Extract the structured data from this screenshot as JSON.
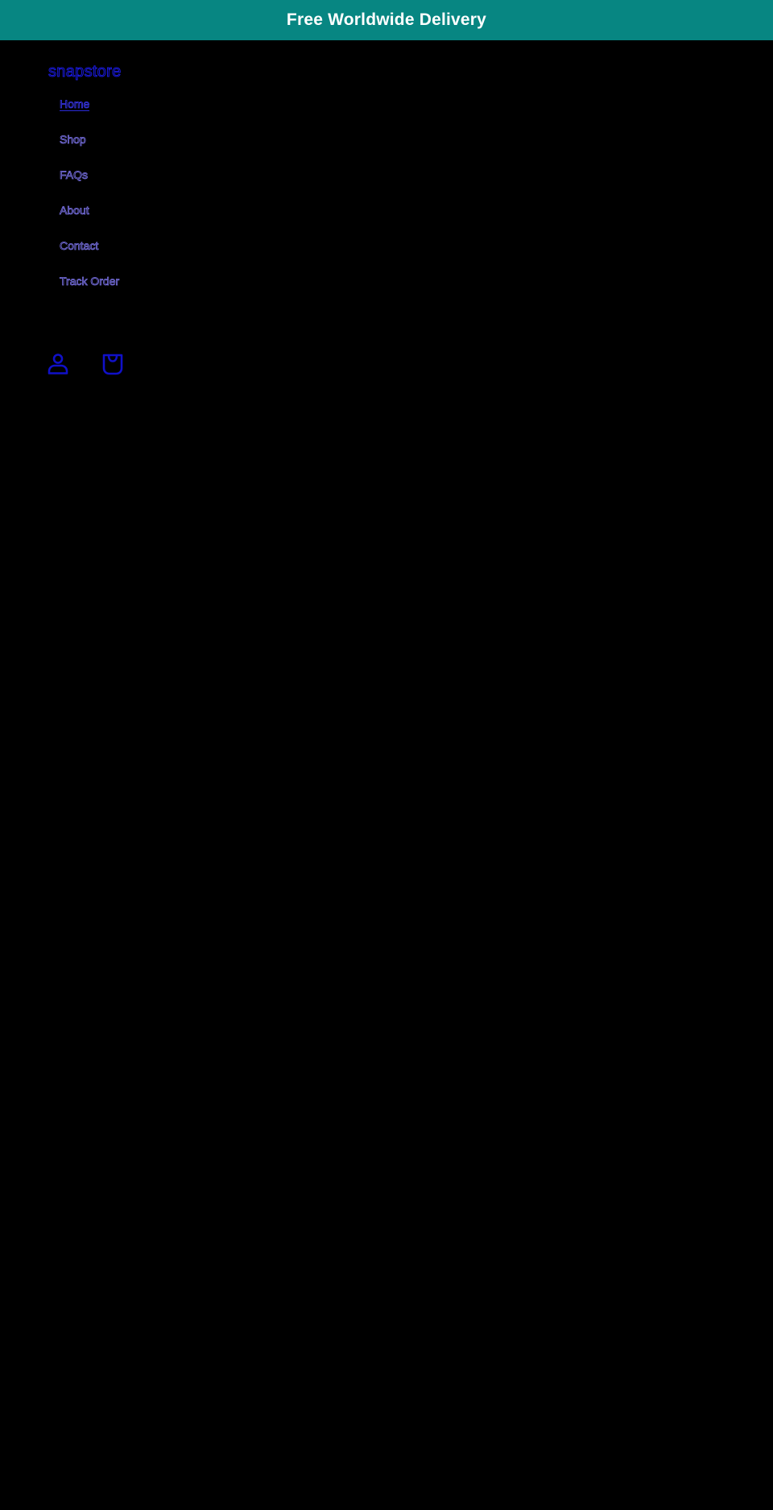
{
  "announcement": {
    "text": "Free Worldwide Delivery"
  },
  "header": {
    "brand": "snapstore"
  },
  "nav": {
    "items": [
      {
        "label": "Home",
        "active": true
      },
      {
        "label": "Shop"
      },
      {
        "label": "FAQs"
      },
      {
        "label": "About"
      },
      {
        "label": "Contact"
      },
      {
        "label": "Track Order"
      }
    ]
  },
  "icons": {
    "account": "user-icon",
    "cart": "shopping-bag-icon"
  },
  "colors": {
    "announcement_bg": "#078682",
    "announcement_text": "#ffffff",
    "page_bg": "#000000",
    "link_outline": "#1a1adf",
    "nav_outline": "#7a72e6"
  }
}
